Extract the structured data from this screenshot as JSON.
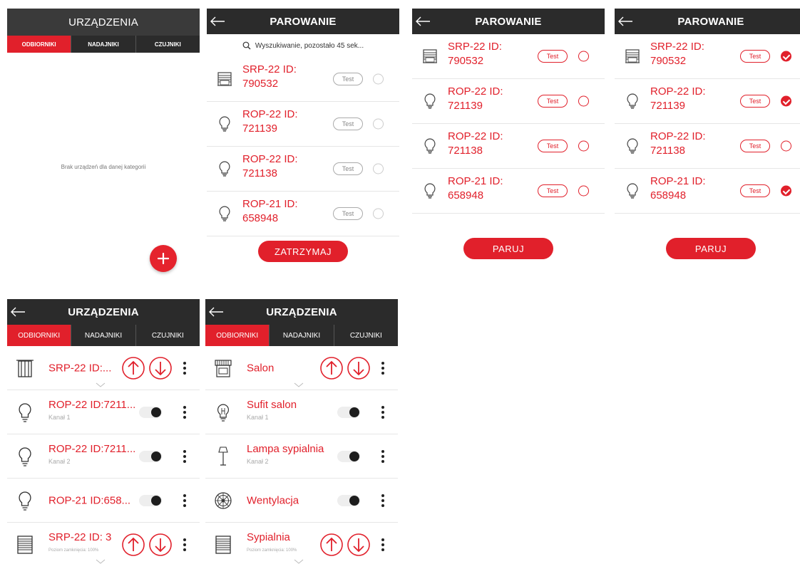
{
  "screen1": {
    "title": "URZĄDZENIA",
    "tabs": [
      "ODBIORNIKI",
      "NADAJNIKI",
      "CZUJNIKI"
    ],
    "empty_text": "Brak urządzeń dla danej kategorii"
  },
  "screen2": {
    "title": "PAROWANIE",
    "search_text": "Wyszukiwanie, pozostało 45 sek...",
    "devices": [
      {
        "line1": "SRP-22 ID:",
        "line2": "790532",
        "test": "Test"
      },
      {
        "line1": "ROP-22 ID:",
        "line2": "721139",
        "test": "Test"
      },
      {
        "line1": "ROP-22 ID:",
        "line2": "721138",
        "test": "Test"
      },
      {
        "line1": "ROP-21 ID:",
        "line2": "658948",
        "test": "Test"
      }
    ],
    "stop_label": "ZATRZYMAJ"
  },
  "screen3": {
    "title": "PAROWANIE",
    "devices": [
      {
        "line1": "SRP-22 ID:",
        "line2": "790532",
        "test": "Test"
      },
      {
        "line1": "ROP-22 ID:",
        "line2": "721139",
        "test": "Test"
      },
      {
        "line1": "ROP-22 ID:",
        "line2": "721138",
        "test": "Test"
      },
      {
        "line1": "ROP-21 ID:",
        "line2": "658948",
        "test": "Test"
      }
    ],
    "pair_label": "PARUJ"
  },
  "screen4": {
    "title": "PAROWANIE",
    "devices": [
      {
        "line1": "SRP-22 ID:",
        "line2": "790532",
        "test": "Test",
        "checked": true
      },
      {
        "line1": "ROP-22 ID:",
        "line2": "721139",
        "test": "Test",
        "checked": true
      },
      {
        "line1": "ROP-22 ID:",
        "line2": "721138",
        "test": "Test",
        "checked": false
      },
      {
        "line1": "ROP-21 ID:",
        "line2": "658948",
        "test": "Test",
        "checked": true
      }
    ],
    "pair_label": "PARUJ"
  },
  "screen5": {
    "title": "URZĄDZENIA",
    "tabs": [
      "ODBIORNIKI",
      "NADAJNIKI",
      "CZUJNIKI"
    ],
    "devices": [
      {
        "name": "SRP-22 ID:...",
        "sub": ""
      },
      {
        "name": "ROP-22 ID:7211...",
        "sub": "Kanał 1"
      },
      {
        "name": "ROP-22 ID:7211...",
        "sub": "Kanał 2"
      },
      {
        "name": "ROP-21 ID:658...",
        "sub": ""
      },
      {
        "name": "SRP-22 ID: 3",
        "sub": "Poziom zamknięcia: 100%"
      }
    ]
  },
  "screen6": {
    "title": "URZĄDZENIA",
    "tabs": [
      "ODBIORNIKI",
      "NADAJNIKI",
      "CZUJNIKI"
    ],
    "devices": [
      {
        "name": "Salon",
        "sub": ""
      },
      {
        "name": "Sufit salon",
        "sub": "Kanał 1"
      },
      {
        "name": "Lampa sypialnia",
        "sub": "Kanał 2"
      },
      {
        "name": "Wentylacja",
        "sub": ""
      },
      {
        "name": "Sypialnia",
        "sub": "Poziom zamknięcia: 100%"
      }
    ]
  },
  "colors": {
    "accent": "#e1202b",
    "header": "#2b2b2b"
  }
}
